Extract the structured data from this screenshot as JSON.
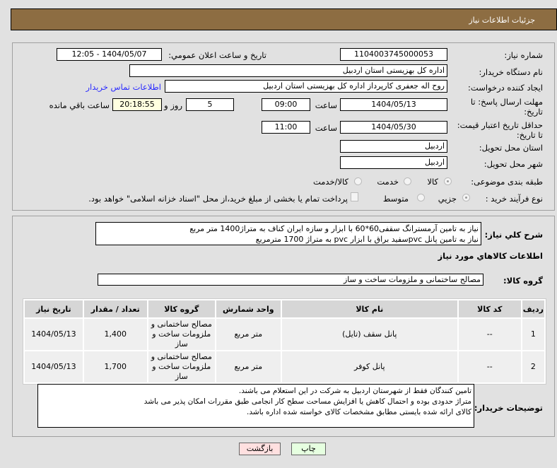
{
  "header": {
    "title": "جزئيات اطلاعات نياز"
  },
  "form": {
    "need_number_label": "شماره نیاز:",
    "need_number": "1104003745000053",
    "announce_label": "تاریخ و ساعت اعلان عمومي:",
    "announce_value": "1404/05/07 - 12:05",
    "buyer_label": "نام دستگاه خریدار:",
    "buyer_value": "اداره کل بهزیستی استان اردبیل",
    "creator_label": "ایجاد کننده درخواست:",
    "creator_value": "روح اله جعفری کارپرداز اداره کل بهزیستی استان اردبیل",
    "contact_link": "اطلاعات تماس خریدار",
    "deadline_label": "مهلت ارسال پاسخ: تا تاریخ:",
    "deadline_date": "1404/05/13",
    "time_label": "ساعت",
    "deadline_time": "09:00",
    "days": "5",
    "days_label": "روز و",
    "remaining": "20:18:55",
    "remaining_label": "ساعت باقي مانده",
    "validity_label": "حداقل تاریخ اعتبار قیمت: تا تاریخ:",
    "validity_date": "1404/05/30",
    "validity_time": "11:00",
    "province_label": "استان محل تحویل:",
    "province": "اردبیل",
    "city_label": "شهر محل تحویل:",
    "city": "اردبیل",
    "category_label": "طبقه بندی موضوعی:",
    "category_options": [
      "کالا",
      "خدمت",
      "کالا/خدمت"
    ],
    "process_label": "نوع فرآیند خرید :",
    "process_options": [
      "جزیي",
      "متوسط"
    ],
    "payment_note": "پرداخت تمام یا بخشی از مبلغ خرید،از محل \"اسناد خزانه اسلامی\" خواهد بود."
  },
  "details": {
    "desc_label": "شرح كلي نياز:",
    "desc_lines": [
      "نیاز به تامین آرمسترانگ سقفی60*60 با ابزار و سازه ایران کناف به متراژ1400 متر مربع",
      "نیاز به تامین پانل pvcسفید براق با ابزار pvc به متراژ 1700 مترمربع"
    ],
    "goods_title": "اطلاعات كالاهاي مورد نياز",
    "group_label": "گروه کالا:",
    "group_value": "مصالح ساختمانی و ملزومات ساخت و ساز",
    "table": {
      "headers": [
        "ردیف",
        "کد کالا",
        "نام کالا",
        "واحد شمارش",
        "گروه کالا",
        "تعداد / مقدار",
        "تاریخ نیاز"
      ],
      "rows": [
        [
          "1",
          "--",
          "پانل سقف (تایل)",
          "متر مربع",
          "مصالح ساختمانی و ملزومات ساخت و ساز",
          "1,400",
          "1404/05/13"
        ],
        [
          "2",
          "--",
          "پانل کوفر",
          "متر مربع",
          "مصالح ساختمانی و ملزومات ساخت و ساز",
          "1,700",
          "1404/05/13"
        ]
      ]
    },
    "notes_label": "توضیحات خریدار:",
    "notes_lines": [
      "تامین کنندگان فقط از شهرستان اردبیل به شرکت در این استعلام می باشند.",
      "متراژ حدودی بوده و احتمال کاهش یا افزایش مساحت سطح کار انجامی طبق مقررات امکان پذیر می باشد",
      "کالای ارائه شده بایستی مطابق مشخصات کالای خواسته شده اداره باشد."
    ]
  },
  "buttons": {
    "print": "چاپ",
    "back": "بازگشت"
  }
}
